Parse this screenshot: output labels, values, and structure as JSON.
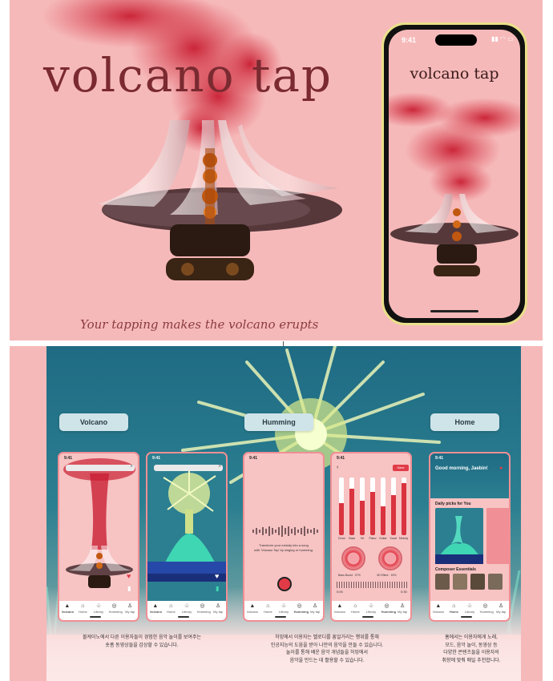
{
  "hero": {
    "title": "volcano tap",
    "tagline": "Your tapping makes the volcano erupts",
    "phone": {
      "time": "9:41",
      "status": "▮▮ ◠ ▭",
      "title": "volcano tap"
    }
  },
  "sections": [
    {
      "label": "Volcano",
      "caption_lines": [
        "볼케이노에서 다른 이용자들이 경험한 음악 놀이를 보여주는",
        "숏폼 동영상들을 감상할 수 있습니다."
      ]
    },
    {
      "label": "Humming",
      "caption_lines": [
        "허밍에서 이용자는 멜로디를 흥얼거리는 행위를 통해",
        "인공지능의 도움을 받아 나만의 음악을 만들 수 있습니다.",
        "놀이를 통해 배운 음악 개념들을 허밍에서",
        "음악을 만드는 데 활용할 수 있습니다."
      ]
    },
    {
      "label": "Home",
      "caption_lines": [
        "홈에서는 이용자에게 노래,",
        "모드, 음악 놀이, 동영상 등",
        "다양한 콘텐츠들을 이용자의",
        "취향에 맞춰 매일 추천합니다."
      ]
    }
  ],
  "screens": {
    "time": "9:41",
    "nav": [
      {
        "label": "Volcano",
        "icon": "▲"
      },
      {
        "label": "Home",
        "icon": "⌂"
      },
      {
        "label": "Library",
        "icon": "♧"
      },
      {
        "label": "Humming",
        "icon": "◎"
      },
      {
        "label": "My tap",
        "icon": "♙"
      }
    ],
    "humming_text": [
      "Transform your melody into a song",
      "with 'Volcano Tap' by singing or humming."
    ],
    "mixer": {
      "save_label": "Save",
      "channels": [
        "Drum",
        "Bass",
        "Kit",
        "Piano",
        "Guitar",
        "Vocal",
        "Melody"
      ],
      "levels": [
        0.55,
        0.8,
        0.6,
        0.75,
        0.5,
        0.7,
        0.9
      ],
      "knob_left_label": "Bass Boost · 27%",
      "knob_right_label": "3D Effect · 19%",
      "time_start": "0:00",
      "time_end": "0:30"
    },
    "home": {
      "greeting": "Good morning, Jaebin!",
      "daily_picks": "Daily picks for You",
      "composer": "Composer Essentials"
    }
  },
  "colors": {
    "accent": "#e23b48",
    "pink_bg": "#f6b9b9",
    "teal": "#2b7f90"
  }
}
